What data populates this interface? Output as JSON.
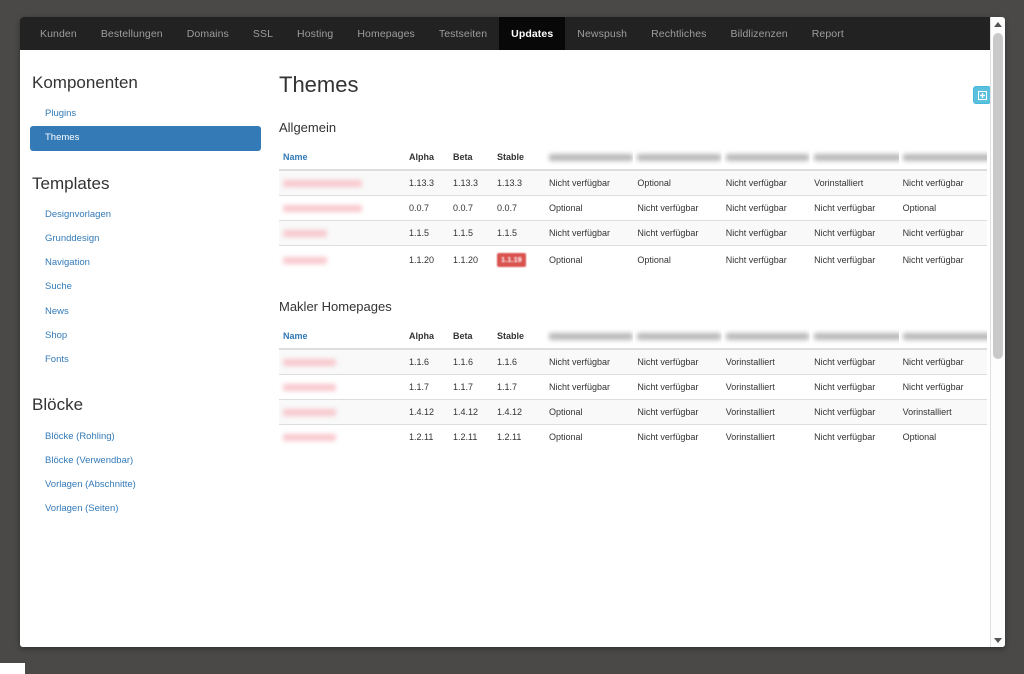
{
  "navbar": {
    "items": [
      {
        "label": "Kunden",
        "active": false
      },
      {
        "label": "Bestellungen",
        "active": false
      },
      {
        "label": "Domains",
        "active": false
      },
      {
        "label": "SSL",
        "active": false
      },
      {
        "label": "Hosting",
        "active": false
      },
      {
        "label": "Homepages",
        "active": false
      },
      {
        "label": "Testseiten",
        "active": false
      },
      {
        "label": "Updates",
        "active": true
      },
      {
        "label": "Newspush",
        "active": false
      },
      {
        "label": "Rechtliches",
        "active": false
      },
      {
        "label": "Bildlizenzen",
        "active": false
      },
      {
        "label": "Report",
        "active": false
      }
    ]
  },
  "sidebar": {
    "groups": [
      {
        "heading": "Komponenten",
        "items": [
          {
            "label": "Plugins",
            "active": false
          },
          {
            "label": "Themes",
            "active": true
          }
        ]
      },
      {
        "heading": "Templates",
        "items": [
          {
            "label": "Designvorlagen",
            "active": false
          },
          {
            "label": "Grunddesign",
            "active": false
          },
          {
            "label": "Navigation",
            "active": false
          },
          {
            "label": "Suche",
            "active": false
          },
          {
            "label": "News",
            "active": false
          },
          {
            "label": "Shop",
            "active": false
          },
          {
            "label": "Fonts",
            "active": false
          }
        ]
      },
      {
        "heading": "Blöcke",
        "items": [
          {
            "label": "Blöcke (Rohling)",
            "active": false
          },
          {
            "label": "Blöcke (Verwendbar)",
            "active": false
          },
          {
            "label": "Vorlagen (Abschnitte)",
            "active": false
          },
          {
            "label": "Vorlagen (Seiten)",
            "active": false
          }
        ]
      }
    ]
  },
  "main": {
    "page_title": "Themes",
    "action_button": {
      "icon": "plus-square-icon",
      "label": ""
    },
    "columns": [
      {
        "label": "Name",
        "redacted": false,
        "sortable": true
      },
      {
        "label": "Alpha",
        "redacted": false,
        "sortable": false
      },
      {
        "label": "Beta",
        "redacted": false,
        "sortable": false
      },
      {
        "label": "Stable",
        "redacted": false,
        "sortable": false
      },
      {
        "label": "Mein Homepagepla -1",
        "redacted": true,
        "sortable": false
      },
      {
        "label": "Mein Homepagepl -10",
        "redacted": true,
        "sortable": false
      },
      {
        "label": "Makler Homepages -1",
        "redacted": true,
        "sortable": false
      },
      {
        "label": "Makler Homepages -10",
        "redacted": true,
        "sortable": false
      },
      {
        "label": "Mein Leistungspaket -1",
        "redacted": true,
        "sortable": false
      }
    ],
    "sections": [
      {
        "title": "Allgemein",
        "rows": [
          {
            "name": "Premium Theme 2020",
            "name_redacted": true,
            "alpha": "1.13.3",
            "beta": "1.13.3",
            "stable": "1.13.3",
            "stable_badge": false,
            "states": [
              "Nicht verfügbar",
              "Optional",
              "Nicht verfügbar",
              "Vorinstalliert",
              "Nicht verfügbar"
            ]
          },
          {
            "name": "Mein Homepagepaket",
            "name_redacted": true,
            "alpha": "0.0.7",
            "beta": "0.0.7",
            "stable": "0.0.7",
            "stable_badge": false,
            "states": [
              "Optional",
              "Nicht verfügbar",
              "Nicht verfügbar",
              "Nicht verfügbar",
              "Optional"
            ]
          },
          {
            "name": "Mein Theme",
            "name_redacted": true,
            "alpha": "1.1.5",
            "beta": "1.1.5",
            "stable": "1.1.5",
            "stable_badge": false,
            "states": [
              "Nicht verfügbar",
              "Nicht verfügbar",
              "Nicht verfügbar",
              "Nicht verfügbar",
              "Nicht verfügbar"
            ]
          },
          {
            "name": "Mein Theme",
            "name_redacted": true,
            "alpha": "1.1.20",
            "beta": "1.1.20",
            "stable": "1.1.19",
            "stable_badge": true,
            "states": [
              "Optional",
              "Optional",
              "Nicht verfügbar",
              "Nicht verfügbar",
              "Nicht verfügbar"
            ]
          }
        ]
      },
      {
        "title": "Makler Homepages",
        "rows": [
          {
            "name": "Makler Theme",
            "name_redacted": true,
            "alpha": "1.1.6",
            "beta": "1.1.6",
            "stable": "1.1.6",
            "stable_badge": false,
            "states": [
              "Nicht verfügbar",
              "Nicht verfügbar",
              "Vorinstalliert",
              "Nicht verfügbar",
              "Nicht verfügbar"
            ]
          },
          {
            "name": "Makler Theme",
            "name_redacted": true,
            "alpha": "1.1.7",
            "beta": "1.1.7",
            "stable": "1.1.7",
            "stable_badge": false,
            "states": [
              "Nicht verfügbar",
              "Nicht verfügbar",
              "Vorinstalliert",
              "Nicht verfügbar",
              "Nicht verfügbar"
            ]
          },
          {
            "name": "Makler Theme",
            "name_redacted": true,
            "alpha": "1.4.12",
            "beta": "1.4.12",
            "stable": "1.4.12",
            "stable_badge": false,
            "states": [
              "Optional",
              "Nicht verfügbar",
              "Vorinstalliert",
              "Nicht verfügbar",
              "Vorinstalliert"
            ]
          },
          {
            "name": "Makler Theme",
            "name_redacted": true,
            "alpha": "1.2.11",
            "beta": "1.2.11",
            "stable": "1.2.11",
            "stable_badge": false,
            "states": [
              "Optional",
              "Nicht verfügbar",
              "Vorinstalliert",
              "Nicht verfügbar",
              "Optional"
            ]
          }
        ]
      }
    ]
  },
  "scrollbar": {
    "up_icon": "caret-up-icon",
    "down_icon": "caret-down-icon"
  },
  "colors": {
    "navbar_bg": "#222222",
    "navbar_active_bg": "#080808",
    "sidebar_active_bg": "#337ab7",
    "link": "#337ab7",
    "badge_danger": "#d9534f",
    "action_button": "#5bc0de",
    "desktop_bg": "#4a4947"
  }
}
